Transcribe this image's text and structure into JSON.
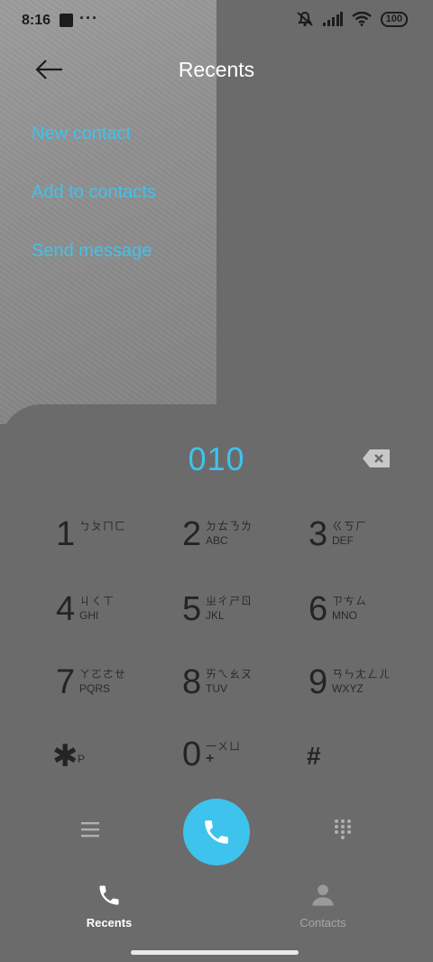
{
  "status_bar": {
    "time": "8:16",
    "dots": "···",
    "battery": "100"
  },
  "header": {
    "title": "Recents",
    "back_icon": "arrow-left-icon"
  },
  "menu": {
    "new_contact": "New contact",
    "add_to_contacts": "Add to contacts",
    "send_message": "Send message"
  },
  "dialer": {
    "number": "010",
    "backspace_icon": "backspace-icon",
    "keys": [
      {
        "digit": "1",
        "zhuyin": "ㄅㄆㄇㄈ",
        "letters": ""
      },
      {
        "digit": "2",
        "zhuyin": "ㄉㄊㄋㄌ",
        "letters": "ABC"
      },
      {
        "digit": "3",
        "zhuyin": "ㄍㄎㄏ",
        "letters": "DEF"
      },
      {
        "digit": "4",
        "zhuyin": "ㄐㄑㄒ",
        "letters": "GHI"
      },
      {
        "digit": "5",
        "zhuyin": "ㄓㄔㄕㄖ",
        "letters": "JKL"
      },
      {
        "digit": "6",
        "zhuyin": "ㄗㄘㄙ",
        "letters": "MNO"
      },
      {
        "digit": "7",
        "zhuyin": "ㄚㄛㄜㄝ",
        "letters": "PQRS"
      },
      {
        "digit": "8",
        "zhuyin": "ㄞㄟㄠㄡ",
        "letters": "TUV"
      },
      {
        "digit": "9",
        "zhuyin": "ㄢㄣㄤㄥㄦ",
        "letters": "WXYZ"
      },
      {
        "digit": "✱",
        "zhuyin": "",
        "letters": "P"
      },
      {
        "digit": "0",
        "zhuyin": "一ㄨㄩ",
        "letters": "+"
      },
      {
        "digit": "#",
        "zhuyin": "",
        "letters": ""
      }
    ]
  },
  "actions": {
    "menu_icon": "menu-lines-icon",
    "call_icon": "phone-icon",
    "keypad_icon": "keypad-grid-icon"
  },
  "nav": {
    "recents": "Recents",
    "contacts": "Contacts"
  },
  "colors": {
    "accent": "#3ec3ec",
    "background": "#6b6b6b",
    "text_dark": "#242424"
  }
}
